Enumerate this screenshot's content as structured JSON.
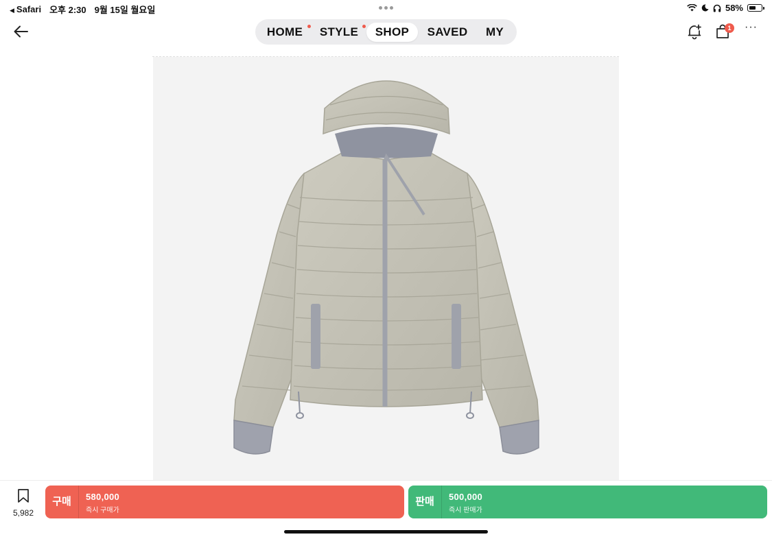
{
  "status_bar": {
    "back_app": "Safari",
    "time": "오후 2:30",
    "date": "9월 15일 월요일",
    "battery": "58%",
    "battery_level": 0.58,
    "icons": [
      "wifi-icon",
      "moon-icon",
      "headphones-icon",
      "battery-icon"
    ]
  },
  "nav": {
    "tabs": [
      {
        "label": "HOME",
        "dot": true
      },
      {
        "label": "STYLE",
        "dot": true
      },
      {
        "label": "SHOP",
        "active": true
      },
      {
        "label": "SAVED"
      },
      {
        "label": "MY"
      }
    ],
    "cart_badge": "1",
    "accent_color": "#ef5b4d"
  },
  "product": {
    "image": "hooded-puffer-jacket-photo",
    "image_bg": "#f3f3f3"
  },
  "actions": {
    "wish_count": "5,982",
    "buy": {
      "type_label": "구매",
      "price": "580,000",
      "sub_label": "즉시 구매가",
      "color": "#ef6253"
    },
    "sell": {
      "type_label": "판매",
      "price": "500,000",
      "sub_label": "즉시 판매가",
      "color": "#41b979"
    }
  }
}
